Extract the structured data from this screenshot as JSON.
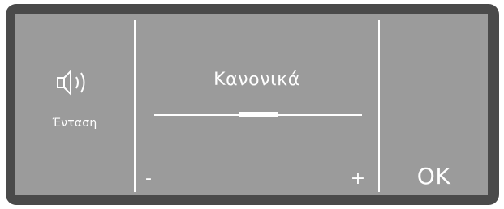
{
  "volume": {
    "icon": "speaker-icon",
    "label": "Ένταση"
  },
  "setting": {
    "value_label": "Κανονικά",
    "level_fraction": 0.5
  },
  "controls": {
    "minus_label": "-",
    "plus_label": "+",
    "ok_label": "OK"
  },
  "colors": {
    "bezel": "#4a4a4a",
    "screen": "#9b9b9b",
    "foreground": "#ffffff"
  }
}
